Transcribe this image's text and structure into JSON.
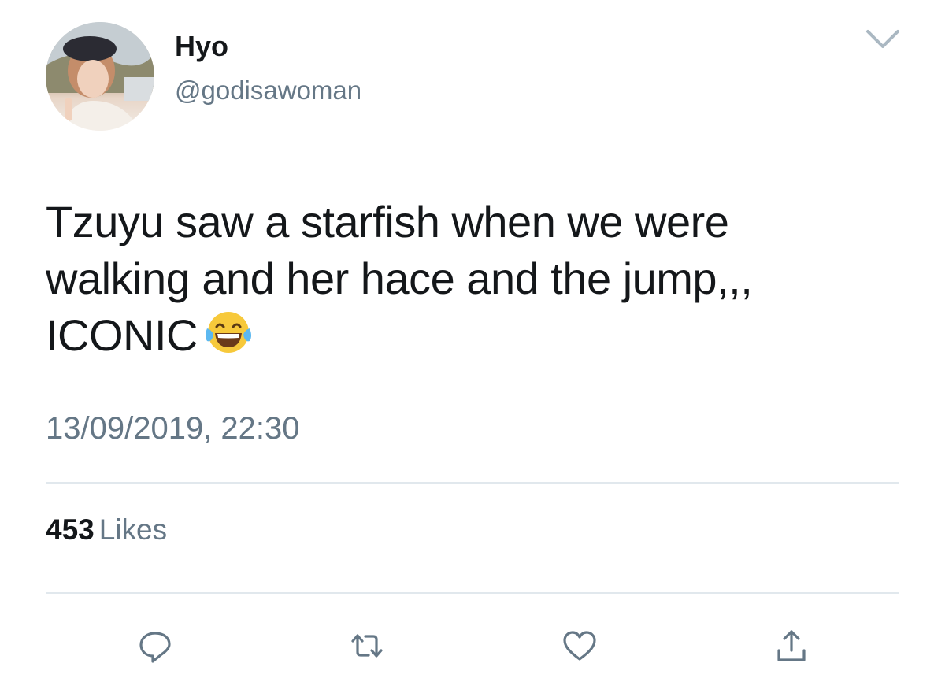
{
  "author": {
    "display_name": "Hyo",
    "handle": "@godisawoman"
  },
  "tweet": {
    "lines": [
      "Tzuyu saw a starfish when we were",
      "walking and her hace and the jump,,,",
      "ICONIC"
    ],
    "emoji": "face-with-tears-of-joy",
    "timestamp": "13/09/2019, 22:30"
  },
  "stats": {
    "likes_count": "453",
    "likes_label": "Likes"
  },
  "icons": {
    "menu": "chevron-down-icon",
    "reply": "reply-icon",
    "retweet": "retweet-icon",
    "like": "heart-icon",
    "share": "share-icon"
  },
  "colors": {
    "text_primary": "#14171a",
    "text_secondary": "#657786",
    "divider": "#e1e8ed",
    "icon": "#657786"
  }
}
